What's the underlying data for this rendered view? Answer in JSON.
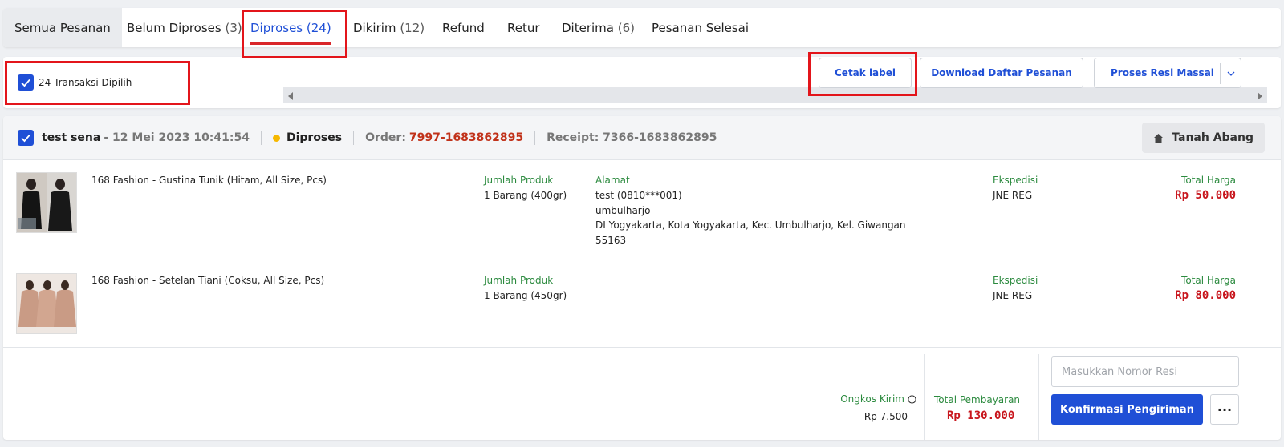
{
  "tabs": [
    {
      "label": "Semua Pesanan",
      "count": ""
    },
    {
      "label": "Belum Diproses",
      "count": "(3)"
    },
    {
      "label": "Diproses",
      "count": "(24)"
    },
    {
      "label": "Dikirim",
      "count": "(12)"
    },
    {
      "label": "Refund",
      "count": ""
    },
    {
      "label": "Retur",
      "count": ""
    },
    {
      "label": "Diterima",
      "count": "(6)"
    },
    {
      "label": "Pesanan Selesai",
      "count": ""
    }
  ],
  "active_tab": "Diproses",
  "toolbar": {
    "selection_label": "24 Transaksi Dipilih",
    "print_label": "Cetak label",
    "download_label": "Download Daftar Pesanan",
    "bulk_receipt_label": "Proses Resi Massal"
  },
  "order": {
    "buyer": "test sena",
    "date": "- 12 Mei 2023 10:41:54",
    "status": "Diproses",
    "order_label": "Order:",
    "order_no": "7997-1683862895",
    "receipt": "Receipt: 7366-1683862895",
    "location": "Tanah Abang",
    "items": [
      {
        "name": "168 Fashion - Gustina Tunik (Hitam, All Size, Pcs)",
        "qty_label": "Jumlah Produk",
        "qty": "1 Barang (400gr)",
        "courier_label": "Ekspedisi",
        "courier": "JNE REG",
        "total_label": "Total Harga",
        "total": "Rp 50.000"
      },
      {
        "name": "168 Fashion - Setelan Tiani (Coksu, All Size, Pcs)",
        "qty_label": "Jumlah Produk",
        "qty": "1 Barang (450gr)",
        "courier_label": "Ekspedisi",
        "courier": "JNE REG",
        "total_label": "Total Harga",
        "total": "Rp 80.000"
      }
    ],
    "address": {
      "label": "Alamat",
      "line1": "test (0810***001)",
      "line2": "umbulharjo",
      "line3": "DI Yogyakarta, Kota Yogyakarta, Kec. Umbulharjo, Kel. Giwangan",
      "line4": "55163"
    },
    "shipping_label": "Ongkos Kirim",
    "shipping": "Rp 7.500",
    "payment_label": "Total Pembayaran",
    "payment": "Rp 130.000",
    "resi_placeholder": "Masukkan Nomor Resi",
    "confirm_label": "Konfirmasi Pengiriman",
    "more_label": "..."
  },
  "colors": {
    "accent": "#1f4fd6",
    "price": "#c8161d",
    "field_label": "#2b8a3e",
    "annotation": "#e3151b"
  }
}
